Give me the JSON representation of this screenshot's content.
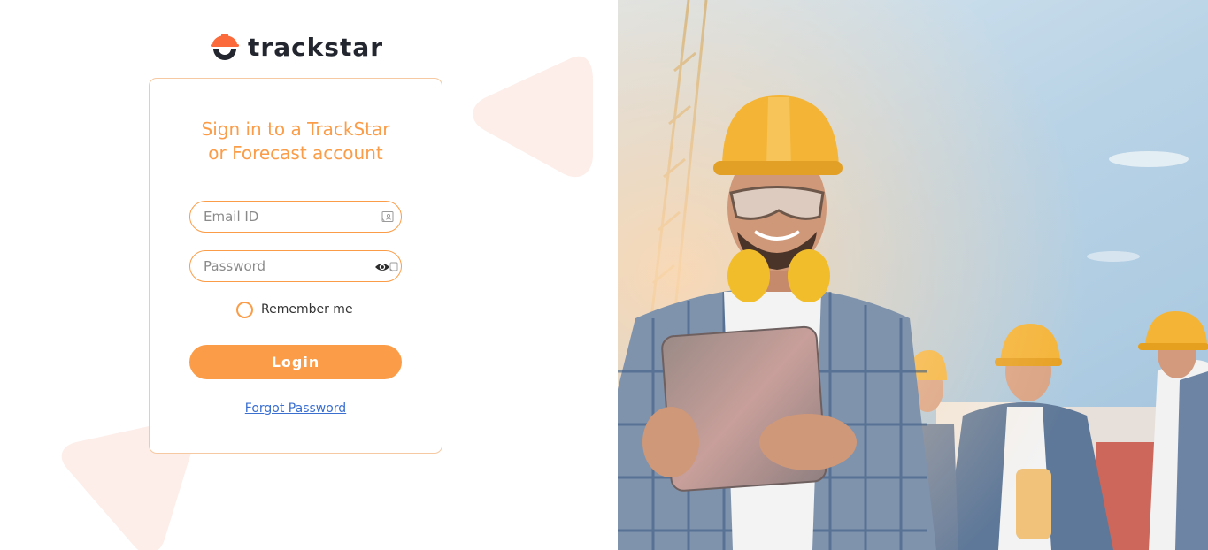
{
  "brand": {
    "name": "trackstar",
    "logo_icon": "hardhat-smile-logo"
  },
  "signin": {
    "heading_line1": "Sign in to a TrackStar",
    "heading_line2": "or Forecast account",
    "email_placeholder": "Email ID",
    "password_placeholder": "Password",
    "remember_label": "Remember me",
    "login_label": "Login",
    "forgot_label": "Forgot Password"
  },
  "icons": {
    "email": "contact-card-icon",
    "password_toggle": "eye-icon",
    "password_manager": "key-icon"
  },
  "colors": {
    "accent": "#fb9d48",
    "card_border": "#f6c9a2",
    "decoration": "#fdeee9",
    "link": "#3a6fd0",
    "brand_text": "#23262f"
  },
  "hero": {
    "image_icon": "construction-workers-photo"
  }
}
